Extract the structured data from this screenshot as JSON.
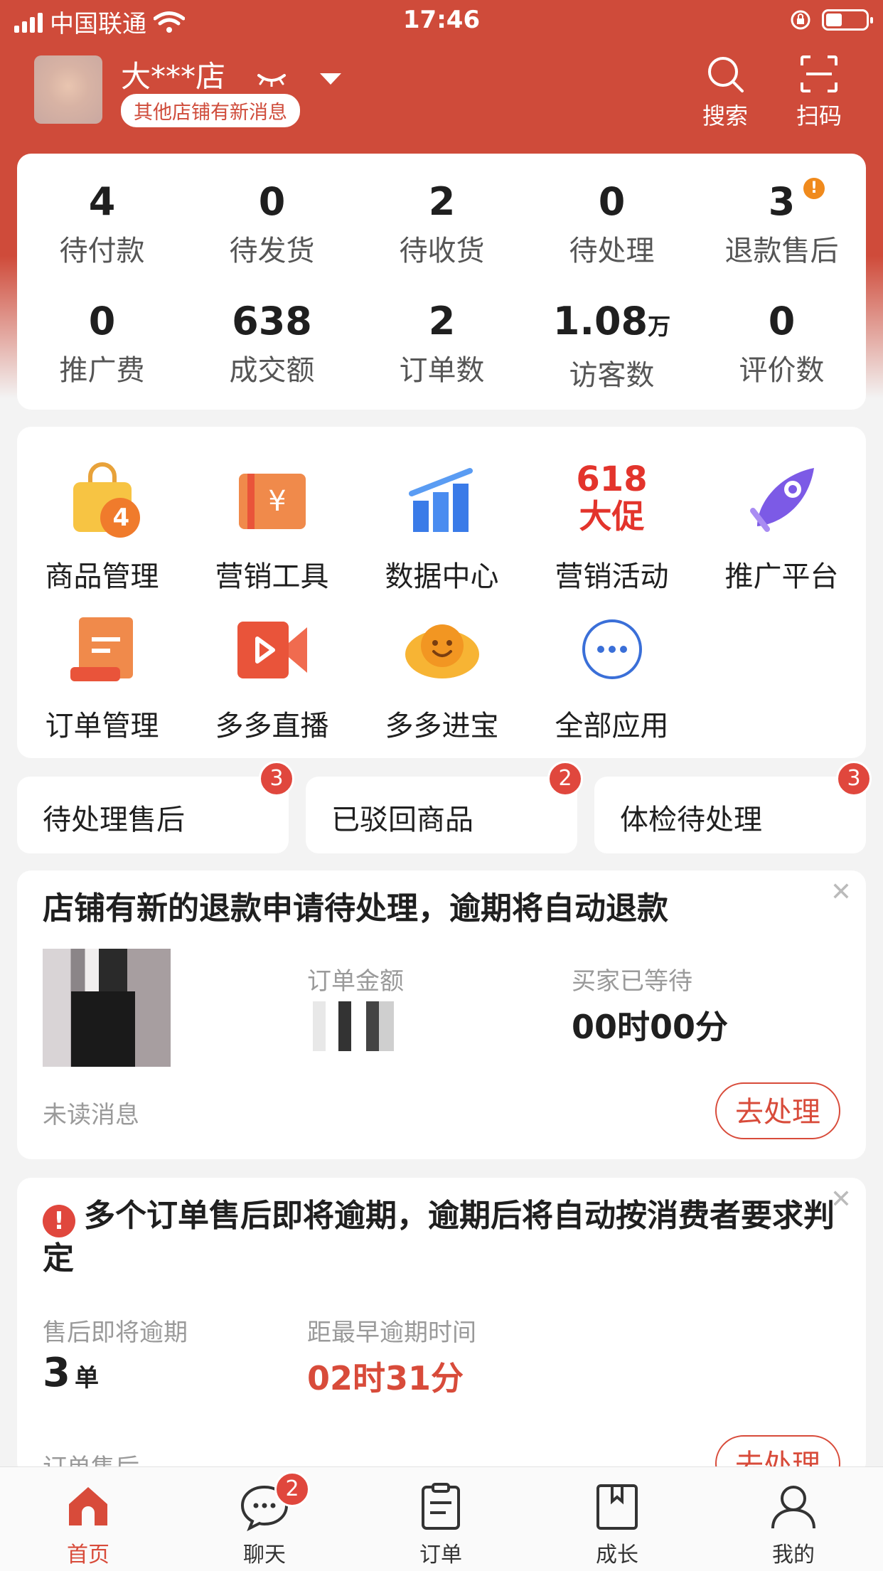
{
  "status_bar": {
    "carrier": "中国联通",
    "time": "17:46"
  },
  "header": {
    "shop_name": "大***店",
    "notice": "其他店铺有新消息",
    "search_label": "搜索",
    "scan_label": "扫码"
  },
  "stats": {
    "row1": [
      {
        "value": "4",
        "label": "待付款"
      },
      {
        "value": "0",
        "label": "待发货"
      },
      {
        "value": "2",
        "label": "待收货"
      },
      {
        "value": "0",
        "label": "待处理"
      },
      {
        "value": "3",
        "label": "退款售后",
        "alert": "!"
      }
    ],
    "row2": [
      {
        "value": "0",
        "label": "推广费"
      },
      {
        "value": "638",
        "label": "成交额"
      },
      {
        "value": "2",
        "label": "订单数"
      },
      {
        "value": "1.08",
        "unit": "万",
        "label": "访客数"
      },
      {
        "value": "0",
        "label": "评价数"
      }
    ]
  },
  "apps": [
    {
      "label": "商品管理",
      "icon": "shopping-bag-icon",
      "badge": "4"
    },
    {
      "label": "营销工具",
      "icon": "coupon-icon"
    },
    {
      "label": "数据中心",
      "icon": "bar-chart-icon"
    },
    {
      "label": "营销活动",
      "icon": "promo-618-icon",
      "text_top": "618",
      "text_bottom": "大促"
    },
    {
      "label": "推广平台",
      "icon": "rocket-icon"
    },
    {
      "label": "订单管理",
      "icon": "order-scroll-icon"
    },
    {
      "label": "多多直播",
      "icon": "live-video-icon"
    },
    {
      "label": "多多进宝",
      "icon": "gold-ingot-icon"
    },
    {
      "label": "全部应用",
      "icon": "more-dots-icon"
    }
  ],
  "quick": [
    {
      "label": "待处理售后",
      "badge": "3"
    },
    {
      "label": "已驳回商品",
      "badge": "2"
    },
    {
      "label": "体检待处理",
      "badge": "3"
    }
  ],
  "message1": {
    "title": "店铺有新的退款申请待处理，逾期将自动退款",
    "order_amount_label": "订单金额",
    "wait_label": "买家已等待",
    "wait_value": "00时00分",
    "footer": "未读消息",
    "action": "去处理"
  },
  "message2": {
    "title": "多个订单售后即将逾期，逾期后将自动按消费者要求判定",
    "due_label": "售后即将逾期",
    "due_value": "3",
    "due_unit": "单",
    "earliest_label": "距最早逾期时间",
    "earliest_value": "02时31分",
    "footer": "订单售后",
    "action": "去处理"
  },
  "tabbar": [
    {
      "label": "首页",
      "icon": "home-icon",
      "active": true
    },
    {
      "label": "聊天",
      "icon": "chat-icon",
      "badge": "2"
    },
    {
      "label": "订单",
      "icon": "order-icon"
    },
    {
      "label": "成长",
      "icon": "book-icon"
    },
    {
      "label": "我的",
      "icon": "user-icon"
    }
  ],
  "colors": {
    "brand": "#cf4b3a",
    "badge": "#e0473d",
    "alert": "#f08a1c"
  }
}
